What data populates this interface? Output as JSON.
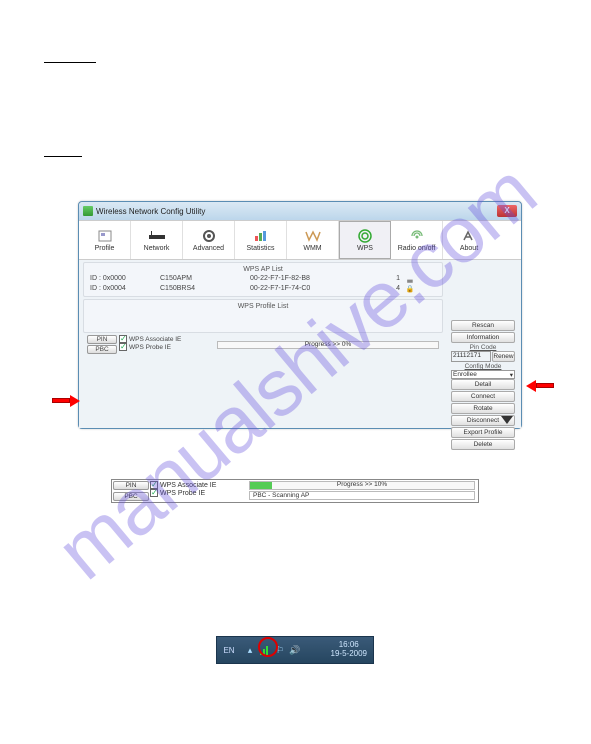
{
  "watermark": "manualshive.com",
  "window": {
    "title": "Wireless Network Config Utility",
    "close_glyph": "X",
    "tabs": {
      "profile": "Profile",
      "network": "Network",
      "advanced": "Advanced",
      "statistics": "Statistics",
      "wmm": "WMM",
      "wps": "WPS",
      "radio": "Radio on/off",
      "about": "About"
    },
    "lists": {
      "ap_header": "WPS AP List",
      "profile_header": "WPS Profile List",
      "ap_rows": [
        {
          "id": "ID : 0x0000",
          "name": "C150APM",
          "mac": "00-22-F7-1F-82-B8",
          "ch": "1"
        },
        {
          "id": "ID : 0x0004",
          "name": "C150BRS4",
          "mac": "00-22-F7-1F-74-C0",
          "ch": "4"
        }
      ]
    },
    "side": {
      "rescan": "Rescan",
      "information": "Information",
      "pin_code": "Pin Code",
      "pin_value": "21112171",
      "renew": "Renew",
      "config_mode": "Config Mode",
      "config_mode_value": "Enrollee",
      "detail": "Detail",
      "connect": "Connect",
      "rotate": "Rotate",
      "disconnect": "Disconnect",
      "export": "Export Profile",
      "delete": "Delete"
    },
    "lower": {
      "pin": "PIN",
      "pbc": "PBC",
      "assoc": "WPS Associate IE",
      "probe": "WPS Probe IE",
      "progress_label": "Progress >> 0%"
    }
  },
  "fragment2": {
    "pin": "PIN",
    "pbc": "PBC",
    "assoc": "WPS Associate IE",
    "probe": "WPS Probe IE",
    "progress_label": "Progress >> 10%",
    "status": "PBC - Scanning AP"
  },
  "systray": {
    "lang": "EN",
    "time": "16:06",
    "date": "19-5-2009"
  },
  "icons": {
    "app": "app-icon",
    "profile": "profile-icon",
    "network": "network-icon",
    "advanced": "gear-icon",
    "statistics": "statistics-icon",
    "wmm": "wmm-icon",
    "wps": "wps-icon",
    "radio": "radio-icon",
    "about": "about-icon",
    "signal": "signal-icon",
    "chevron": "chevron-icon",
    "speaker": "speaker-icon",
    "lock": "lock-icon"
  }
}
